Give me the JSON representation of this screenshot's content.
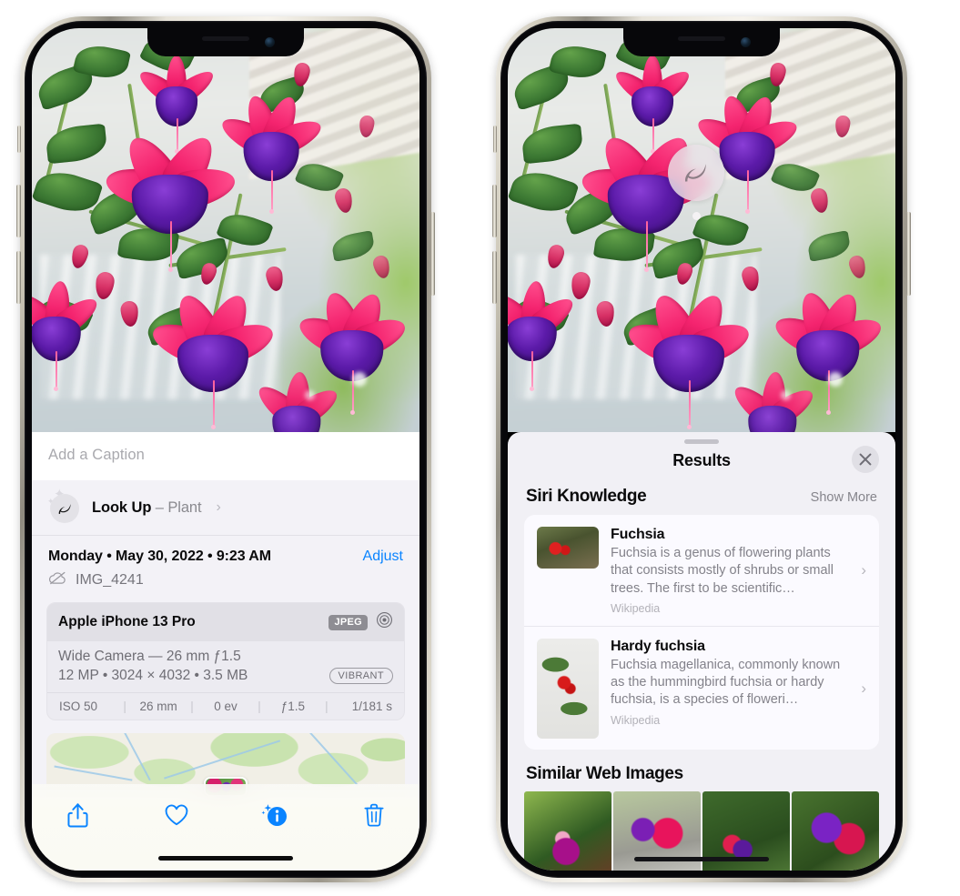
{
  "left_phone": {
    "name": "iphone-photos-info",
    "caption_field": {
      "placeholder": "Add a Caption",
      "value": ""
    },
    "look_up": {
      "label": "Look Up",
      "separator": "–",
      "subject": "Plant",
      "chevron": "›",
      "icon": "leaf-icon"
    },
    "date_row": {
      "date": "Monday • May 30, 2022 • 9:23 AM",
      "adjust_label": "Adjust"
    },
    "file_row": {
      "filename": "IMG_4241",
      "icon": "icloud-slash-icon"
    },
    "exif": {
      "device": "Apple iPhone 13 Pro",
      "format_chip": "JPEG",
      "aperture_icon": "lens-icon",
      "lens_line": "Wide Camera — 26 mm ƒ1.5",
      "size_line": "12 MP • 3024 × 4032 • 3.5 MB",
      "style_chip": "VIBRANT",
      "stats": [
        "ISO 50",
        "26 mm",
        "0 ev",
        "ƒ1.5",
        "1/181 s"
      ]
    },
    "map": {
      "name": "location-map"
    },
    "toolbar": {
      "share": "share-icon",
      "favorite": "heart-icon",
      "info": "info-sparkle-icon",
      "delete": "trash-icon"
    },
    "accent_color": "#0a84ff"
  },
  "right_phone": {
    "name": "iphone-visual-lookup-results",
    "badge": {
      "icon": "leaf-icon",
      "label": "visual-look-up-badge"
    },
    "sheet": {
      "title": "Results",
      "close_icon": "close-icon",
      "siri_section": {
        "title": "Siri Knowledge",
        "show_more": "Show More",
        "items": [
          {
            "title": "Fuchsia",
            "description": "Fuchsia is a genus of flowering plants that consists mostly of shrubs or small trees. The first to be scientific…",
            "source": "Wikipedia",
            "chevron": "›",
            "thumb": "fuchsia-red-flowers-thumb"
          },
          {
            "title": "Hardy fuchsia",
            "description": "Fuchsia magellanica, commonly known as the hummingbird fuchsia or hardy fuchsia, is a species of floweri…",
            "source": "Wikipedia",
            "chevron": "›",
            "thumb": "hardy-fuchsia-specimen-thumb"
          }
        ]
      },
      "web_section": {
        "title": "Similar Web Images",
        "images": [
          "fuchsia-web-image-1",
          "fuchsia-web-image-2",
          "fuchsia-web-image-3",
          "fuchsia-web-image-4"
        ]
      }
    }
  }
}
